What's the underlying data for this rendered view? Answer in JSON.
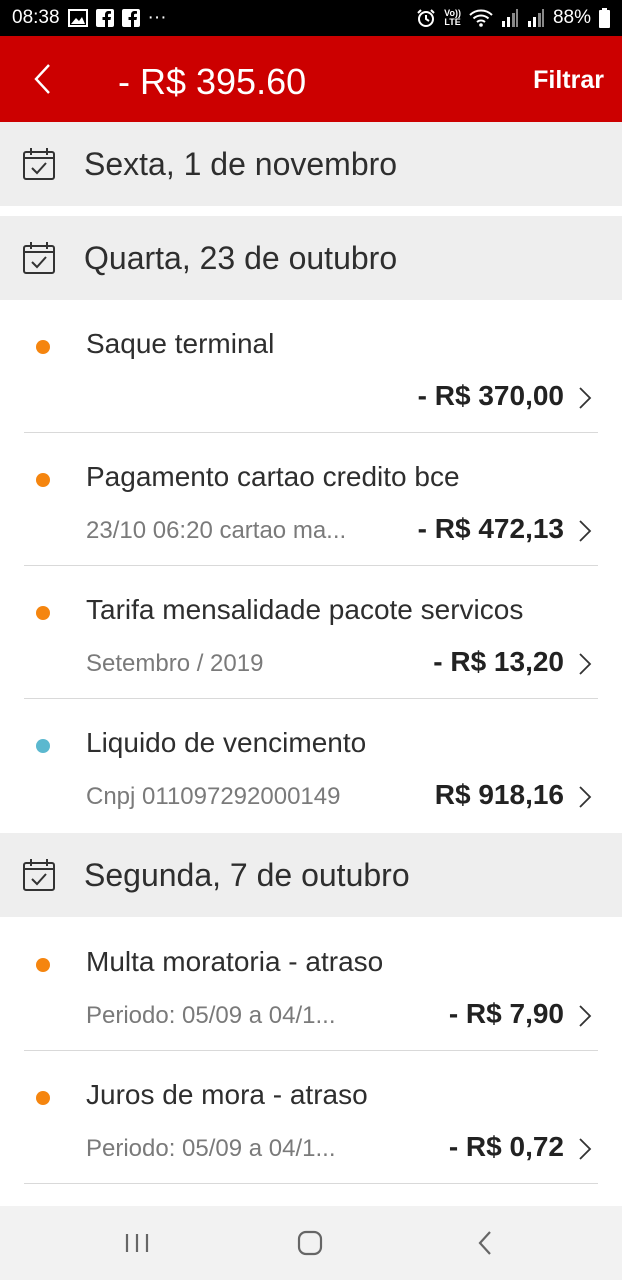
{
  "status_bar": {
    "time": "08:38",
    "more": "···",
    "volte": "Vo))",
    "lte": "LTE",
    "battery": "88%"
  },
  "header": {
    "title": "- R$ 395.60",
    "filter_label": "Filtrar",
    "background_color": "#cc0000"
  },
  "groups": [
    {
      "date": "Sexta, 1 de novembro",
      "transactions": []
    },
    {
      "date": "Quarta, 23 de outubro",
      "transactions": [
        {
          "title": "Saque terminal",
          "subtitle": "",
          "amount": "- R$ 370,00",
          "dot_color": "#f5850f"
        },
        {
          "title": "Pagamento cartao credito bce",
          "subtitle": "23/10 06:20 cartao ma...",
          "amount": "- R$ 472,13",
          "dot_color": "#f5850f"
        },
        {
          "title": "Tarifa mensalidade pacote servicos",
          "subtitle": "Setembro / 2019",
          "amount": "- R$ 13,20",
          "dot_color": "#f5850f"
        },
        {
          "title": "Liquido de vencimento",
          "subtitle": "Cnpj 011097292000149",
          "amount": "R$ 918,16",
          "dot_color": "#5bb8cf"
        }
      ]
    },
    {
      "date": "Segunda, 7 de outubro",
      "transactions": [
        {
          "title": "Multa moratoria - atraso",
          "subtitle": "Periodo: 05/09 a 04/1...",
          "amount": "- R$ 7,90",
          "dot_color": "#f5850f"
        },
        {
          "title": "Juros de mora - atraso",
          "subtitle": "Periodo: 05/09 a 04/1...",
          "amount": "- R$ 0,72",
          "dot_color": "#f5850f"
        }
      ]
    }
  ],
  "icons": {
    "calendar": "calendar-icon",
    "chevron": "chevron-right-icon",
    "back": "back-arrow-icon"
  }
}
